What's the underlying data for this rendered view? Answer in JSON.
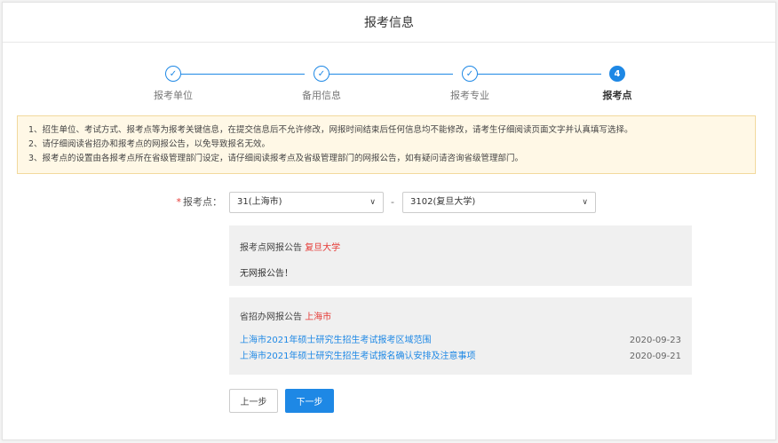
{
  "header": {
    "title": "报考信息"
  },
  "steps": [
    {
      "label": "报考单位",
      "state": "done"
    },
    {
      "label": "备用信息",
      "state": "done"
    },
    {
      "label": "报考专业",
      "state": "done"
    },
    {
      "label": "报考点",
      "state": "active",
      "number": "4"
    }
  ],
  "notice": {
    "lines": [
      "1、招生单位、考试方式、报考点等为报考关键信息，在提交信息后不允许修改，网报时间结束后任何信息均不能修改，请考生仔细阅读页面文字并认真填写选择。",
      "2、请仔细阅读省招办和报考点的网报公告，以免导致报名无效。",
      "3、报考点的设置由各报考点所在省级管理部门设定，请仔细阅读报考点及省级管理部门的网报公告，如有疑问请咨询省级管理部门。"
    ]
  },
  "form": {
    "required_mark": "*",
    "label": "报考点：",
    "province_select": "31(上海市)",
    "separator": "-",
    "site_select": "3102(复旦大学)"
  },
  "site_notice": {
    "title": "报考点网报公告",
    "highlight": "复旦大学",
    "content": "无网报公告！"
  },
  "province_notice": {
    "title": "省招办网报公告",
    "highlight": "上海市",
    "items": [
      {
        "text": "上海市2021年硕士研究生招生考试报考区域范围",
        "date": "2020-09-23"
      },
      {
        "text": "上海市2021年硕士研究生招生考试报名确认安排及注意事项",
        "date": "2020-09-21"
      }
    ]
  },
  "buttons": {
    "prev": "上一步",
    "next": "下一步"
  },
  "colors": {
    "primary": "#1e88e5",
    "highlight": "#e53935",
    "notice_bg": "#fff8e6"
  }
}
